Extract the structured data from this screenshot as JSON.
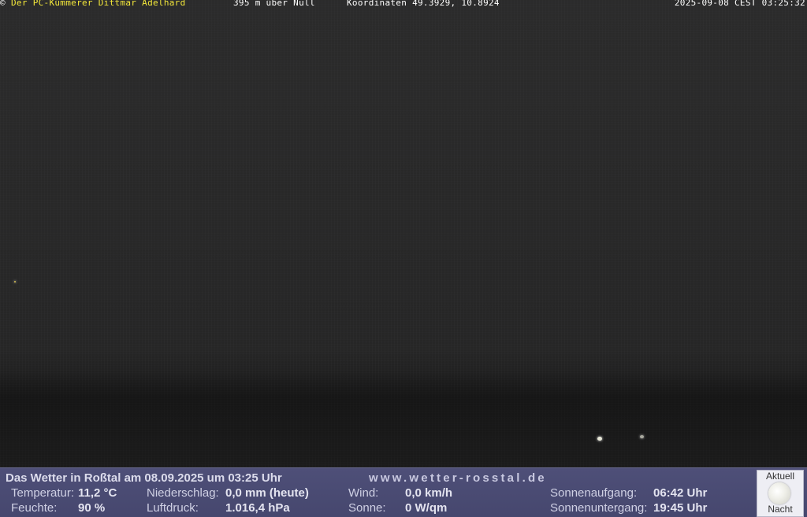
{
  "overlay": {
    "copyright_symbol": "©",
    "owner": "Der PC-Kümmerer Dittmar Adelhard",
    "altitude": "395 m über Null",
    "coordinates": "Koordinaten 49.3929, 10.8924",
    "timestamp": "2025-09-08 CEST 03:25:32"
  },
  "weather": {
    "title": "Das Wetter in Roßtal am 08.09.2025 um 03:25 Uhr",
    "url": "www.wetter-rosstal.de",
    "temperature_label": "Temperatur:",
    "temperature_value": "11,2 °C",
    "humidity_label": "Feuchte:",
    "humidity_value": "90 %",
    "precip_label": "Niederschlag:",
    "precip_value": "0,0 mm (heute)",
    "pressure_label": "Luftdruck:",
    "pressure_value": "1.016,4 hPa",
    "wind_label": "Wind:",
    "wind_value": "0,0 km/h",
    "sun_label": "Sonne:",
    "sun_value": "0 W/qm",
    "sunrise_label": "Sonnenaufgang:",
    "sunrise_value": "06:42 Uhr",
    "sunset_label": "Sonnenuntergang:",
    "sunset_value": "19:45 Uhr"
  },
  "moon": {
    "top_label": "Aktuell",
    "bottom_label": "Nacht",
    "icon": "full-moon-icon"
  },
  "colors": {
    "owner_text": "#f4e83a",
    "panel_bg": "#4e4f78"
  }
}
